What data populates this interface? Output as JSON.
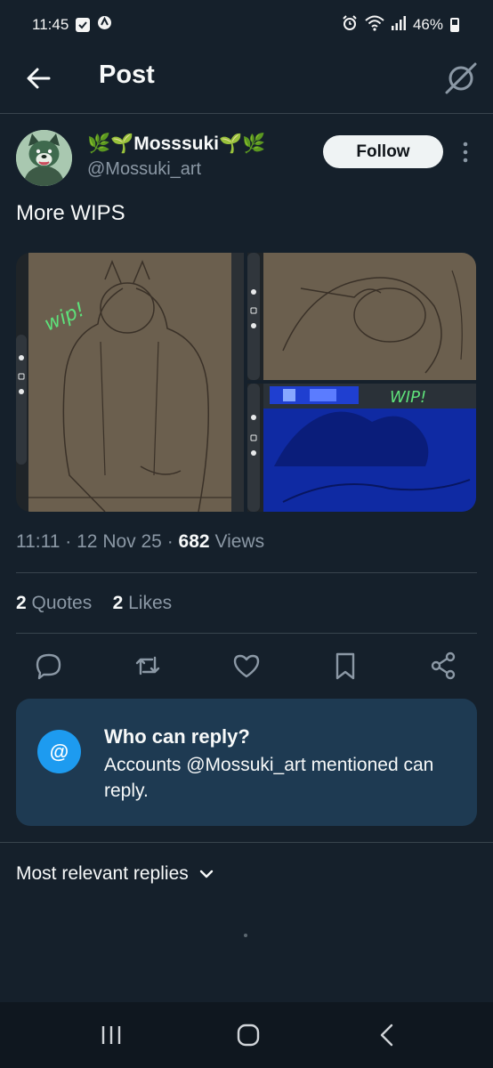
{
  "status_bar": {
    "time": "11:45",
    "battery": "46%",
    "icons": [
      "notification-box-icon",
      "vpn-icon",
      "alarm-icon",
      "wifi-icon",
      "signal-icon",
      "battery-icon"
    ]
  },
  "header": {
    "title": "Post",
    "back_icon": "arrow-left-icon",
    "grok_icon": "grok-icon"
  },
  "post": {
    "author": {
      "display_name": "Mosssuki",
      "name_prefix": "🌿🌱",
      "name_suffix": "🌱🌿",
      "handle": "@Mossuki_art"
    },
    "follow_label": "Follow",
    "text": "More WIPS",
    "media": {
      "image1_caption": "wip!",
      "image3_caption": "WIP!"
    },
    "time": "11:11",
    "date": "12 Nov 25",
    "separator": "·",
    "views_count": "682",
    "views_label": "Views",
    "quotes_count": "2",
    "quotes_label": "Quotes",
    "likes_count": "2",
    "likes_label": "Likes"
  },
  "actions": [
    "reply-icon",
    "repost-icon",
    "like-icon",
    "bookmark-icon",
    "share-icon"
  ],
  "reply_restriction": {
    "title": "Who can reply?",
    "body": "Accounts @Mossuki_art mentioned can reply.",
    "icon_glyph": "@"
  },
  "replies": {
    "sort_label": "Most relevant replies"
  },
  "colors": {
    "background": "#15202b",
    "card": "#1e3a52",
    "accent": "#1d9bf0",
    "muted_text": "#8b98a5",
    "divider": "#38444d"
  }
}
